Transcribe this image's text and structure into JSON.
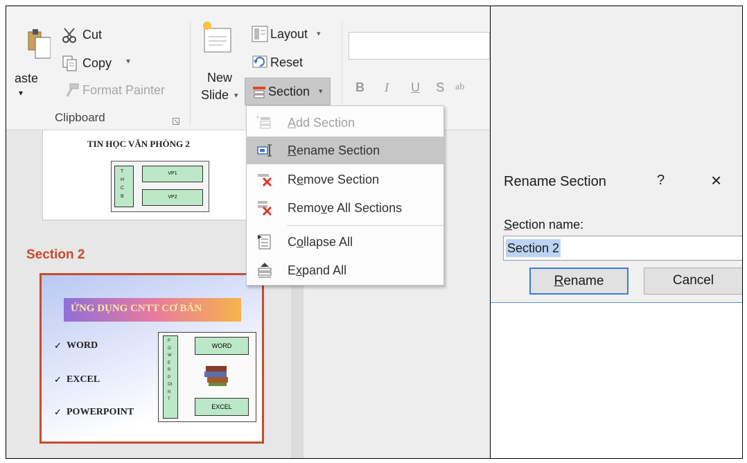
{
  "ribbon": {
    "clipboard": {
      "paste_label": "aste",
      "cut_label": "Cut",
      "copy_label": "Copy",
      "format_painter_label": "Format Painter",
      "group_label": "Clipboard"
    },
    "slides": {
      "new_slide_line1": "New",
      "new_slide_line2": "Slide",
      "layout_label": "Layout",
      "reset_label": "Reset",
      "section_label": "Section"
    },
    "font": {
      "bold": "B",
      "italic": "I",
      "underline": "U",
      "strike": "S",
      "more": "ab"
    }
  },
  "section_menu": {
    "items": [
      {
        "label_pre": "",
        "label_key": "A",
        "label_post": "dd Section",
        "enabled": false,
        "icon": "add-section-icon"
      },
      {
        "label_pre": "",
        "label_key": "R",
        "label_post": "ename Section",
        "enabled": true,
        "highlighted": true,
        "icon": "rename-section-icon"
      },
      {
        "label_pre": "R",
        "label_key": "e",
        "label_post": "move Section",
        "enabled": true,
        "icon": "remove-section-icon"
      },
      {
        "label_pre": "Remo",
        "label_key": "v",
        "label_post": "e All Sections",
        "enabled": true,
        "icon": "remove-all-sections-icon"
      },
      {
        "label_pre": "C",
        "label_key": "o",
        "label_post": "llapse All",
        "enabled": true,
        "icon": "collapse-all-icon"
      },
      {
        "label_pre": "E",
        "label_key": "x",
        "label_post": "pand All",
        "enabled": true,
        "icon": "expand-all-icon"
      }
    ]
  },
  "slide_panel": {
    "slide1": {
      "title": "TIN HỌC VĂN PHÒNG 2",
      "side_text": "THCB",
      "box1": "VP1",
      "box2": "VP2"
    },
    "section2_label": "Section 2",
    "slide2": {
      "title": "ỨNG DỤNG CNTT CƠ BẢN",
      "bullets": [
        "WORD",
        "EXCEL",
        "POWERPOINT"
      ],
      "side_text": "POWERPOINT",
      "box_word": "WORD",
      "box_excel": "EXCEL"
    }
  },
  "dialog": {
    "title": "Rename Section",
    "help": "?",
    "close": "×",
    "field_label_key": "S",
    "field_label_rest": "ection name:",
    "value": "Section 2",
    "rename_key": "R",
    "rename_rest": "ename",
    "cancel": "Cancel",
    "accent_color": "#3d7cd4",
    "selection_color": "#bcd4f2"
  },
  "colors": {
    "section_accent": "#c94a2c",
    "menu_highlight": "#c6c6c6"
  }
}
